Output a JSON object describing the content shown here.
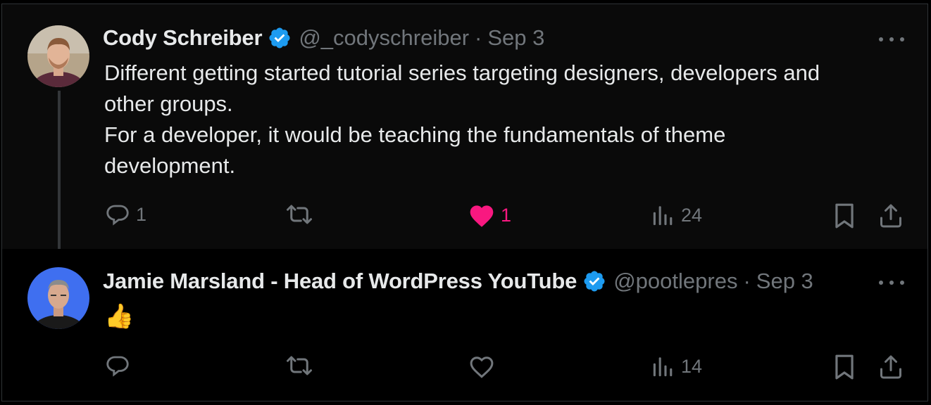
{
  "tweets": [
    {
      "name": "Cody Schreiber",
      "verified": true,
      "handle": "@_codyschreiber",
      "separator": "·",
      "date": "Sep 3",
      "lines": [
        "Different getting started tutorial series targeting designers, developers and",
        "other groups.",
        "For a developer, it would be teaching the fundamentals of theme",
        "development."
      ],
      "actions": {
        "reply_count": "1",
        "retweet_count": "",
        "like_count": "1",
        "liked": true,
        "views_count": "24"
      },
      "icons": [
        "reply-icon",
        "retweet-icon",
        "heart-filled-icon",
        "views-icon",
        "bookmark-icon",
        "share-icon",
        "more-icon"
      ]
    },
    {
      "name": "Jamie Marsland - Head of WordPress YouTube",
      "verified": true,
      "handle": "@pootlepres",
      "separator": "·",
      "date": "Sep 3",
      "emoji": "👍",
      "actions": {
        "reply_count": "",
        "retweet_count": "",
        "like_count": "",
        "liked": false,
        "views_count": "14"
      },
      "icons": [
        "reply-icon",
        "retweet-icon",
        "heart-icon",
        "views-icon",
        "bookmark-icon",
        "share-icon",
        "more-icon"
      ]
    }
  ],
  "colors": {
    "background": "#000000",
    "text": "#e7e9ea",
    "secondary": "#71767b",
    "verified": "#1d9bf0",
    "like": "#f91880"
  }
}
